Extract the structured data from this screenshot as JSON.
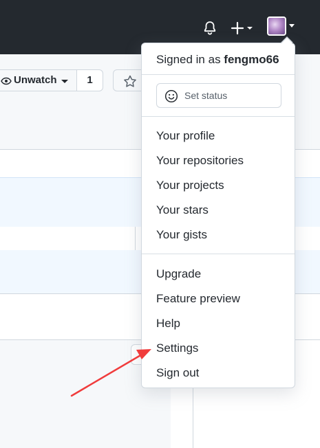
{
  "header": {
    "bell_icon": "bell-icon",
    "create_icon": "plus-icon",
    "avatar_icon": "avatar"
  },
  "repo_actions": {
    "watch_label": "Unwatch",
    "watch_count": "1",
    "star_icon": "star-icon"
  },
  "user_menu": {
    "signed_in_prefix": "Signed in as ",
    "username": "fengmo66",
    "set_status_label": "Set status",
    "profile_items": [
      "Your profile",
      "Your repositories",
      "Your projects",
      "Your stars",
      "Your gists"
    ],
    "account_items": [
      "Upgrade",
      "Feature preview",
      "Help",
      "Settings",
      "Sign out"
    ]
  },
  "annotation": {
    "arrow_color": "#f03c3c"
  },
  "colors": {
    "header_bg": "#24292f",
    "border": "#d0d7de",
    "highlight_row": "#f1f8ff"
  }
}
